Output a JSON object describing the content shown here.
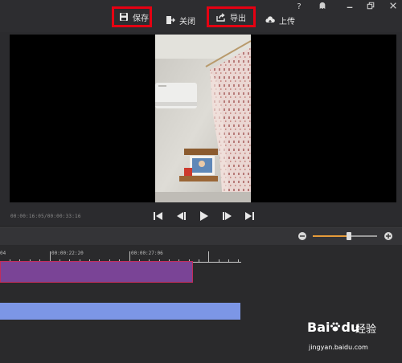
{
  "toolbar": {
    "save_label": "保存",
    "close_label": "关闭",
    "export_label": "导出",
    "upload_label": "上传"
  },
  "window": {
    "help": "?",
    "highlight_color": "#e60012"
  },
  "player": {
    "timecode": "00:00:16:05/00:00:33:16"
  },
  "zoom": {
    "level": 0.56
  },
  "timeline": {
    "ruler_labels": [
      "00:00:22:20",
      "00:00:27:06"
    ],
    "ruler_partial": "04",
    "video_clip_color": "#7a4496",
    "audio_clip_color": "#7c96e6"
  },
  "watermark": {
    "logo": "Bai",
    "logo2": "du",
    "brand_cn": "经验",
    "url": "jingyan.baidu.com"
  }
}
